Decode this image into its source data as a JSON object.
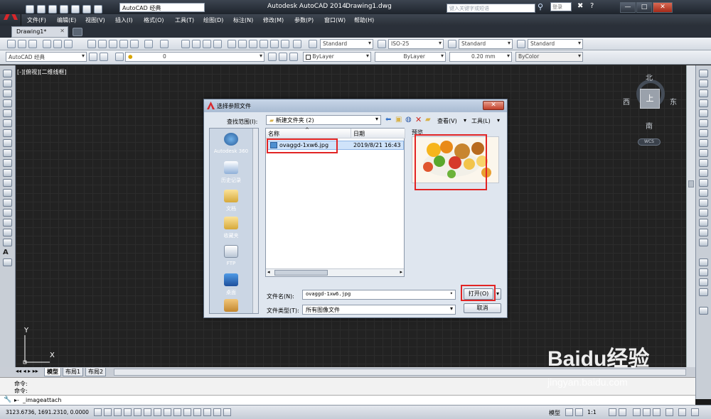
{
  "app": {
    "title": "Autodesk AutoCAD 2014",
    "drawing_title": "Drawing1.dwg",
    "workspace_quick": "AutoCAD 经典",
    "search_placeholder": "键入关键字或短语",
    "login": "登录",
    "window_controls": [
      "—",
      "□",
      "✕"
    ]
  },
  "menu": [
    "文件(F)",
    "编辑(E)",
    "视图(V)",
    "插入(I)",
    "格式(O)",
    "工具(T)",
    "绘图(D)",
    "标注(N)",
    "修改(M)",
    "参数(P)",
    "窗口(W)",
    "帮助(H)"
  ],
  "doc_tab": {
    "label": "Drawing1*"
  },
  "styles": {
    "text_style": "Standard",
    "dim_style": "ISO-25",
    "table_style": "Standard",
    "mleader_style": "Standard"
  },
  "layers": {
    "workspace": "AutoCAD 经典",
    "layer": "0",
    "color": "ByLayer",
    "linetype": "ByLayer",
    "lineweight": "0.20 mm",
    "plotstyle": "ByColor"
  },
  "viewport_label": "[-][俯视][二维线框]",
  "viewcube": {
    "top": "上",
    "north": "北",
    "south": "南",
    "east": "东",
    "west": "西",
    "wcs": "WCS"
  },
  "ucs": {
    "x": "X",
    "y": "Y"
  },
  "layout_tabs": [
    "模型",
    "布局1",
    "布局2"
  ],
  "command": {
    "history": [
      "命令:",
      "命令:"
    ],
    "input": "_imageattach"
  },
  "status": {
    "coords": "3123.6736,  1691.2310,  0.0000",
    "model": "模型",
    "scale": "1:1"
  },
  "dialog": {
    "title": "选择参照文件",
    "lookin_label": "查找范围(I):",
    "lookin_value": "新建文件夹 (2)",
    "views_label": "查看(V)",
    "tools_label": "工具(L)",
    "places": [
      "Autodesk 360",
      "历史记录",
      "文档",
      "收藏夹",
      "FTP",
      "桌面"
    ],
    "columns": {
      "name": "名称",
      "date": "日期"
    },
    "file": {
      "name": "ovaggd-1xw6.jpg",
      "date": "2019/8/21 16:43"
    },
    "preview_label": "预览",
    "filename_label": "文件名(N):",
    "filename_value": "ovaggd-1xw6.jpg",
    "filetype_label": "文件类型(T):",
    "filetype_value": "所有图像文件",
    "open_button": "打开(O)",
    "cancel_button": "取消"
  },
  "watermark": {
    "brand": "Baidu经验",
    "url": "jingyan.baidu.com"
  },
  "colors": {
    "accent_red": "#e22424",
    "canvas": "#222222",
    "dialog_bg": "#dfe6ef",
    "selection": "#cfe3fa"
  }
}
